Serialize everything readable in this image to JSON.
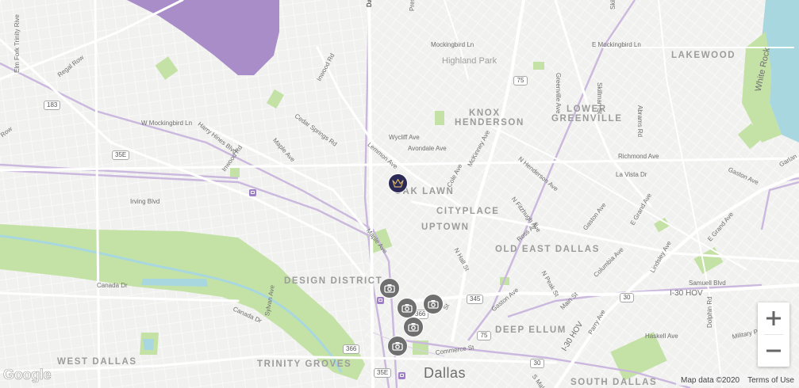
{
  "map": {
    "colors": {
      "land": "#f1f1ef",
      "road": "#ffffff",
      "park": "#bfe0a0",
      "water": "#a8d7e0",
      "transit": "#c9b7dc",
      "airport": "#a98dc8",
      "marker_venue": "#2c2a57",
      "marker_camera": "#6f6f6f"
    },
    "neighborhoods": {
      "lakewood": "LAKEWOOD",
      "knox_henderson_1": "KNOX",
      "knox_henderson_2": "HENDERSON",
      "lower_greenville_1": "LOWER",
      "lower_greenville_2": "GREENVILLE",
      "oak_lawn": "OAK LAWN",
      "cityplace": "CITYPLACE",
      "uptown": "UPTOWN",
      "old_east_dallas": "OLD EAST DALLAS",
      "design_district": "DESIGN DISTRICT",
      "deep_ellum": "DEEP ELLUM",
      "west_dallas": "WEST DALLAS",
      "trinity_groves": "TRINITY GROVES",
      "south_dallas": "SOUTH DALLAS"
    },
    "places": {
      "highland_park": "Highland Park",
      "dallas": "Dallas"
    },
    "streets": {
      "elm_fork": "Elm Fork Trinity Rive",
      "regal_row": "Regal Row",
      "regal_row_2": "Row",
      "w_mockingbird": "W Mockingbird Ln",
      "harry_hines": "Harry Hines Blvd",
      "inwood_rd": "Inwood Rd",
      "inwood_rd_2": "Inwood Rd",
      "cedar_springs": "Cedar Springs Rd",
      "maple_ave": "Maple Ave",
      "maple_ave_2": "Maple Ave",
      "irving_blvd": "Irving Blvd",
      "canada_dr": "Canada Dr",
      "canada_dr_2": "Canada Dr",
      "sylvan_ave": "Sylvan Ave",
      "lemmon_ave": "Lemmon Ave",
      "wycliff_ave": "Wycliff Ave",
      "avondale_ave": "Avondale Ave",
      "cole_ave": "Cole Ave",
      "mckinney_ave": "McKinney Ave",
      "mockingbird_ln": "Mockingbird Ln",
      "e_mockingbird": "E Mockingbird Ln",
      "greenville_ave": "Greenville Ave",
      "skillman_st": "Skillman St",
      "abrams_rd": "Abrams Rd",
      "n_henderson": "N Henderson Ave",
      "richmond_ave": "Richmond Ave",
      "la_vista": "La Vista Dr",
      "gaston_ave": "Gaston Ave",
      "gaston_ave_2": "Gaston Ave",
      "gaston_ave_3": "Gaston Ave",
      "n_fitzhugh": "N Fitzhugh Ave",
      "ross_ave": "Ross Ave",
      "n_hall": "N Hall St",
      "n_peak": "N Peak St",
      "columbia_ave": "Columbia Ave",
      "lindsley_ave": "Lindsley Ave",
      "e_grand": "E Grand Ave",
      "e_grand_2": "E Grand Ave",
      "samuell_blvd": "Samuell Blvd",
      "i30_hov": "I-30 HOV",
      "i30_hov_2": "I-30 HOV",
      "main_st": "Main St",
      "commerce_st": "Commerce St",
      "parry_ave": "Parry Ave",
      "haskell_ave": "Haskell Ave",
      "military_pkwy": "Military P",
      "dolphin_rd": "Dolphin Rd",
      "garland": "Garlan",
      "white_rock": "White Rock",
      "s_malcolm_x": "S Malco",
      "st_partial": "St",
      "greenville_top": "Dallas N",
      "preston_top": "Preston Rd",
      "skillman_top": "Skillm"
    },
    "shields": [
      "183",
      "35E",
      "75",
      "75",
      "345",
      "366",
      "366",
      "35E",
      "30",
      "30",
      "75",
      "366"
    ],
    "markers": {
      "venue": {
        "name": "venue-marker",
        "type": "venue"
      },
      "cameras": [
        "photo-marker",
        "photo-marker",
        "photo-marker",
        "photo-marker",
        "photo-marker"
      ]
    },
    "controls": {
      "zoom_in": "+",
      "zoom_out": "−"
    },
    "attribution": {
      "logo": "Google",
      "map_data": "Map data ©2020",
      "terms": "Terms of Use"
    }
  }
}
